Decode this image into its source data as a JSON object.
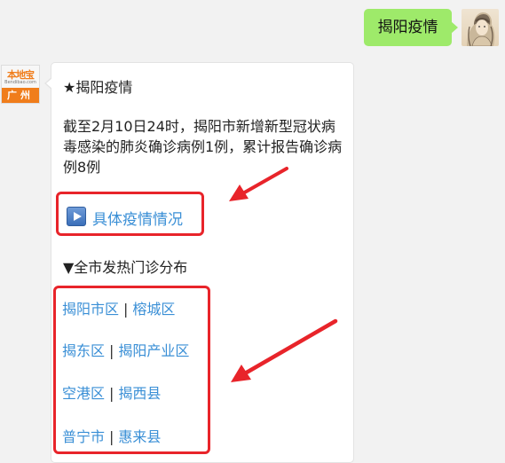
{
  "user_message": {
    "text": "揭阳疫情"
  },
  "bot": {
    "logo_top": "本地宝",
    "logo_url": "Bendibao.com",
    "logo_city": "广州"
  },
  "reply": {
    "title": "★揭阳疫情",
    "body": "截至2月10日24时，揭阳市新增新型冠状病毒感染的肺炎确诊病例1例，累计报告确诊病例8例",
    "detail_link": "具体疫情情况",
    "section_title": "▼全市发热门诊分布",
    "separator": "|",
    "districts": [
      [
        "揭阳市区",
        "榕城区"
      ],
      [
        "揭东区",
        "揭阳产业区"
      ],
      [
        "空港区",
        "揭西县"
      ],
      [
        "普宁市",
        "惠来县"
      ]
    ]
  },
  "colors": {
    "link": "#3a8fd6",
    "bubble_green": "#9eea6a",
    "annotation_red": "#e8242a"
  },
  "icons": [
    "play-icon",
    "user-avatar",
    "bendibao-logo",
    "red-arrow"
  ]
}
